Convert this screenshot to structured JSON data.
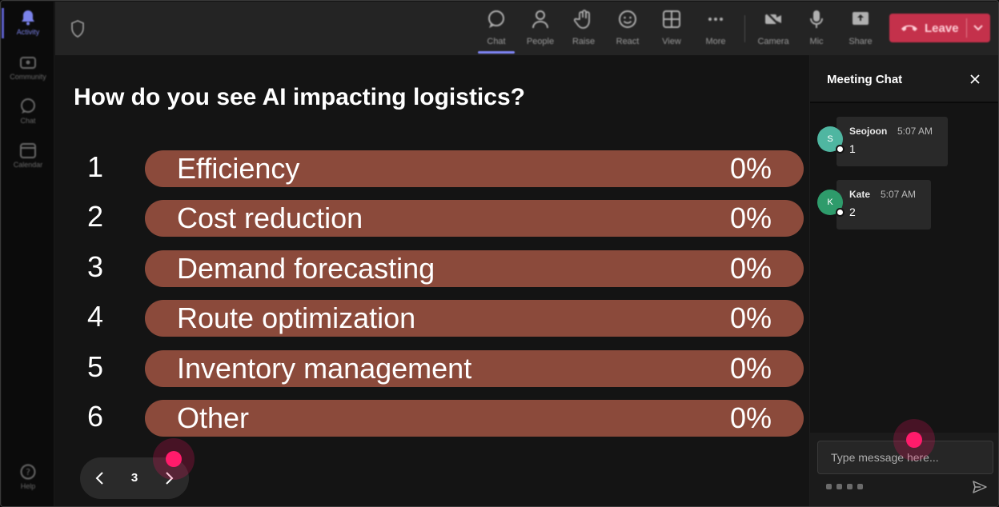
{
  "rail": {
    "items": [
      {
        "label": "Activity",
        "icon": "bell-icon",
        "active": true
      },
      {
        "label": "Community",
        "icon": "community-icon",
        "active": false
      },
      {
        "label": "Chat",
        "icon": "chat-icon",
        "active": false
      },
      {
        "label": "Calendar",
        "icon": "calendar-icon",
        "active": false
      }
    ],
    "help": {
      "label": "Help",
      "icon": "help-icon"
    }
  },
  "toolbar": {
    "buttons": [
      {
        "label": "Chat",
        "icon": "chat-icon",
        "active": true
      },
      {
        "label": "People",
        "icon": "people-icon"
      },
      {
        "label": "Raise",
        "icon": "raise-hand-icon"
      },
      {
        "label": "React",
        "icon": "react-icon"
      },
      {
        "label": "View",
        "icon": "view-icon"
      },
      {
        "label": "More",
        "icon": "more-icon"
      },
      {
        "label": "Camera",
        "icon": "camera-off-icon"
      },
      {
        "label": "Mic",
        "icon": "mic-icon"
      },
      {
        "label": "Share",
        "icon": "share-icon"
      }
    ],
    "leave_label": "Leave",
    "leave_color": "#c4314b",
    "accent_color": "#7f85f5"
  },
  "poll": {
    "title": "How do you see AI impacting logistics?",
    "bar_color": "#8b4a3b",
    "options": [
      {
        "number": "1",
        "label": "Efficiency",
        "percent": "0%"
      },
      {
        "number": "2",
        "label": "Cost reduction",
        "percent": "0%"
      },
      {
        "number": "3",
        "label": "Demand forecasting",
        "percent": "0%"
      },
      {
        "number": "4",
        "label": "Route optimization",
        "percent": "0%"
      },
      {
        "number": "5",
        "label": "Inventory management",
        "percent": "0%"
      },
      {
        "number": "6",
        "label": "Other",
        "percent": "0%"
      }
    ],
    "pager": {
      "page": "3"
    }
  },
  "chat": {
    "title": "Meeting Chat",
    "messages": [
      {
        "initial": "S",
        "name": "Seojoon",
        "time": "5:07 AM",
        "text": "1",
        "avatar_color": "#4fb6a1"
      },
      {
        "initial": "K",
        "name": "Kate",
        "time": "5:07 AM",
        "text": "2",
        "avatar_color": "#2e9b6b"
      }
    ],
    "compose_placeholder": "Type message here..."
  }
}
